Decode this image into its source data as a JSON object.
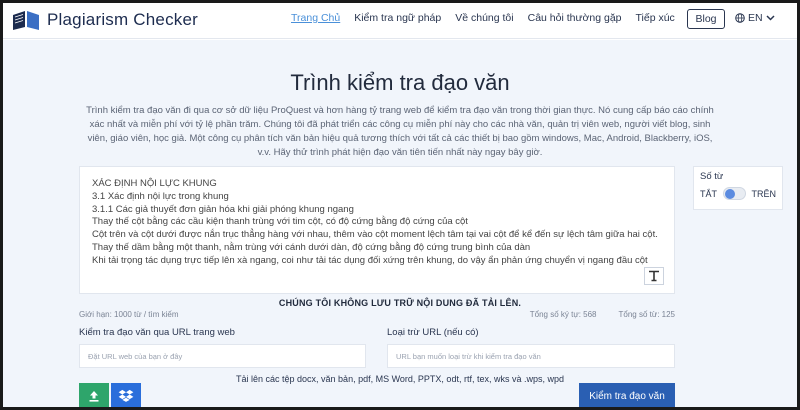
{
  "header": {
    "logo_text": "Plagiarism Checker",
    "nav": [
      {
        "label": "Trang Chủ",
        "active": true
      },
      {
        "label": "Kiểm tra ngữ pháp",
        "active": false
      },
      {
        "label": "Về chúng tôi",
        "active": false
      },
      {
        "label": "Câu hỏi thường gặp",
        "active": false
      },
      {
        "label": "Tiếp xúc",
        "active": false
      }
    ],
    "blog_label": "Blog",
    "language": "EN",
    "globe_icon": "globe-icon",
    "chevron_icon": "chevron-down-icon"
  },
  "main": {
    "title": "Trình kiểm tra đạo văn",
    "description": "Trình kiểm tra đạo văn đi qua cơ sở dữ liệu ProQuest và hơn hàng tỷ trang web để kiểm tra đạo văn trong thời gian thực. Nó cung cấp báo cáo chính xác nhất và miễn phí với tỷ lệ phần trăm. Chúng tôi đã phát triển các công cụ miễn phí này cho các nhà văn, quản trị viên web, người viết blog, sinh viên, giáo viên, học giả. Một công cụ phân tích văn bản hiệu quả tương thích với tất cả các thiết bị bao gồm windows, Mac, Android, Blackberry, iOS, v.v. Hãy thử trình phát hiện đạo văn tiên tiến nhất này ngay bây giờ.",
    "editor_lines": [
      "XÁC ĐỊNH NỘI LỰC KHUNG",
      "3.1 Xác định nội lực trong khung",
      "3.1.1 Các giả thuyết đơn giản hóa khi giải phóng khung ngang",
      "Thay thế cột bằng các cầu kiện thanh trùng với tim cột, có độ cứng bằng độ cứng của cột",
      "Cột trên và cột dưới được nắn trục thẳng hàng với nhau, thêm vào cột moment lệch tâm tại vai cột để kể đến sự lệch tâm giữa hai cột.",
      "Thay thế dầm bằng một thanh, nằm trùng với cánh dưới dàn, độ cứng bằng độ cứng trung bình của dàn",
      "Khi tải trọng tác dụng trực tiếp lên xà ngang, coi như tải tác dụng đối xứng trên khung, do vậy ẩn phản ứng chuyển vị ngang đầu cột"
    ],
    "text_tool_icon": "text-format-icon",
    "side_panel": {
      "title": "Số từ",
      "off_label": "TẮT",
      "on_label": "TRÊN",
      "toggle_on": false
    },
    "notice": "CHÚNG TÔI KHÔNG LƯU TRỮ NỘI DUNG ĐÃ TẢI LÊN.",
    "limit_text": "Giới hạn: 1000 từ / tìm kiếm",
    "char_count": "Tổng số ký tự: 568",
    "word_count": "Tổng số từ: 125",
    "url_label": "Kiểm tra đạo văn qua URL trang web",
    "url_placeholder": "Đặt URL web của bạn ở đây",
    "exclude_label": "Loại trừ URL (nếu có)",
    "exclude_placeholder": "URL bạn muốn loại trừ khi kiểm tra đạo văn",
    "upload_note": "Tải lên các tệp docx, văn bản, pdf, MS Word, PPTX, odt, rtf, tex, wks và .wps, wpd",
    "upload_icon": "upload-icon",
    "dropbox_icon": "dropbox-icon",
    "check_button": "Kiểm tra đạo văn",
    "colors": {
      "upload_green": "#2ea56b",
      "dropbox_blue": "#2a6edb",
      "primary_blue": "#2a5fb3",
      "active_link": "#4a90d9"
    }
  }
}
